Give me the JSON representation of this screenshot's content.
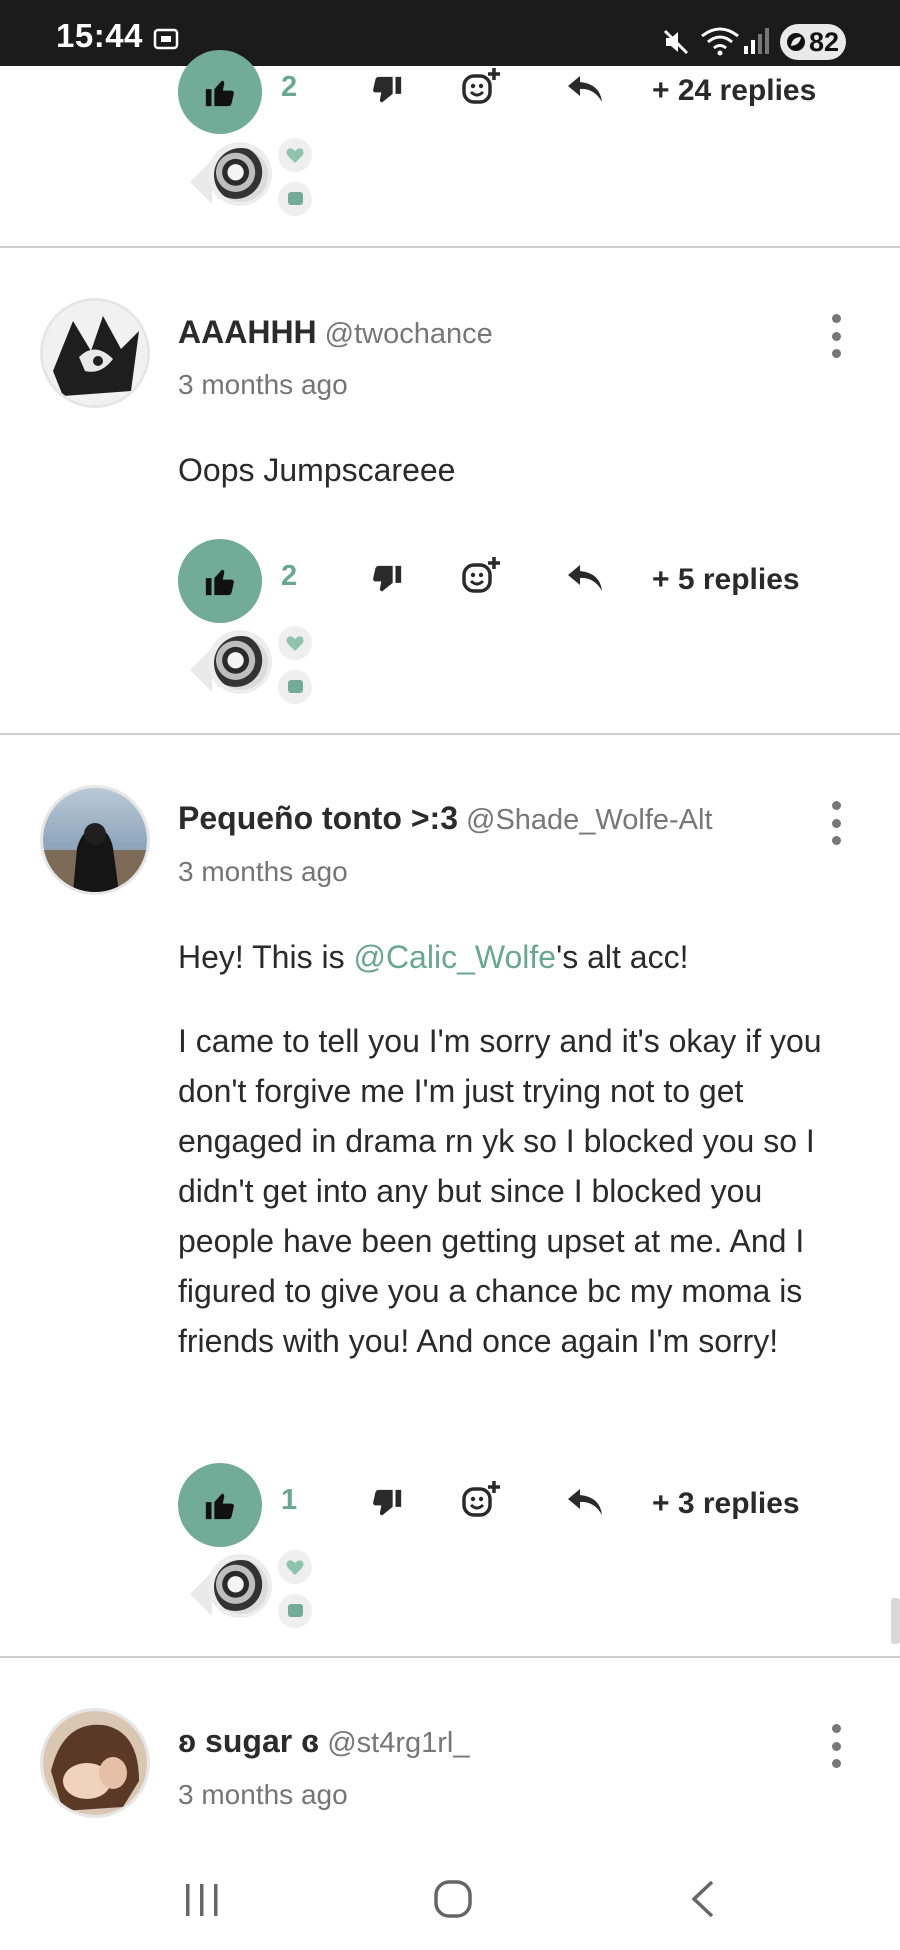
{
  "status_bar": {
    "time": "15:44",
    "battery": "82",
    "icons": [
      "screen-cast-icon",
      "mute-icon",
      "wifi-icon",
      "signal-icon",
      "battery-icon"
    ]
  },
  "top_comment_partial": {
    "likes": "2",
    "replies": "+ 24 replies"
  },
  "comments": [
    {
      "author": "AAAHHH",
      "handle": "@twochance",
      "time": "3 months ago",
      "text": "Oops Jumpscareee",
      "likes": "2",
      "replies": "+ 5 replies"
    },
    {
      "author": "Pequeño tonto >:3",
      "handle": "@Shade_Wolfe-Alt",
      "time": "3 months ago",
      "text_part1": "Hey! This is ",
      "mention": "@Calic_Wolfe",
      "text_part2": "'s alt acc!",
      "text_para2": "I came to tell you I'm sorry and it's okay if you don't forgive me I'm just trying not to get engaged in drama rn yk so I blocked you so I didn't get into any but since I blocked you people have been getting upset at me. And I figured to give you a chance bc my moma is friends with you! And once again I'm sorry!",
      "likes": "1",
      "replies": "+ 3 replies"
    },
    {
      "author": "ʚ sugar ɞ",
      "handle": "@st4rg1rl_",
      "time": "3 months ago"
    }
  ],
  "colors": {
    "accent": "#72ab97",
    "mention": "#6aa792",
    "status_bar_bg": "#1b1b1b"
  }
}
